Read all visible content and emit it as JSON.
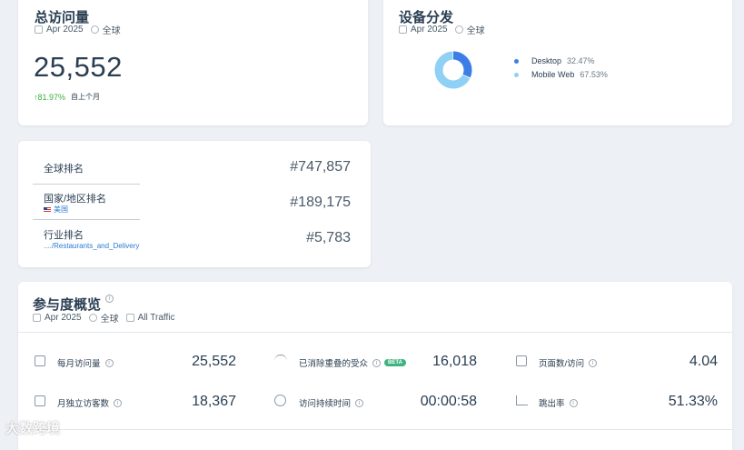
{
  "visits_card": {
    "title": "总访问量",
    "date": "Apr 2025",
    "region": "全球",
    "value": "25,552",
    "change": "↑81.97%",
    "change_label": "自上个月"
  },
  "device_card": {
    "title": "设备分发",
    "date": "Apr 2025",
    "region": "全球",
    "items": [
      {
        "name": "Desktop",
        "pct": "32.47%",
        "color": "#3d7ee6"
      },
      {
        "name": "Mobile Web",
        "pct": "67.53%",
        "color": "#8fd0f5"
      }
    ]
  },
  "chart_data": {
    "type": "pie",
    "categories": [
      "Desktop",
      "Mobile Web"
    ],
    "values": [
      32.47,
      67.53
    ],
    "colors": [
      "#3d7ee6",
      "#8fd0f5"
    ]
  },
  "rank_card": {
    "global_label": "全球排名",
    "global_value": "#747,857",
    "country_label": "国家/地区排名",
    "country_name": "美国",
    "country_value": "#189,175",
    "industry_label": "行业排名",
    "industry_name": "..../Restaurants_and_Delivery",
    "industry_value": "#5,783"
  },
  "engagement": {
    "title": "参与度概览",
    "date": "Apr 2025",
    "region": "全球",
    "traffic": "All Traffic",
    "beta": "BETA",
    "metrics": {
      "monthly_visits_label": "每月访问量",
      "monthly_visits_value": "25,552",
      "dedup_label": "已消除重叠的受众",
      "dedup_value": "16,018",
      "pages_label": "页面数/访问",
      "pages_value": "4.04",
      "unique_label": "月独立访客数",
      "unique_value": "18,367",
      "duration_label": "访问持续时间",
      "duration_value": "00:00:58",
      "bounce_label": "跳出率",
      "bounce_value": "51.33%"
    }
  },
  "watermark": "大数跨境"
}
